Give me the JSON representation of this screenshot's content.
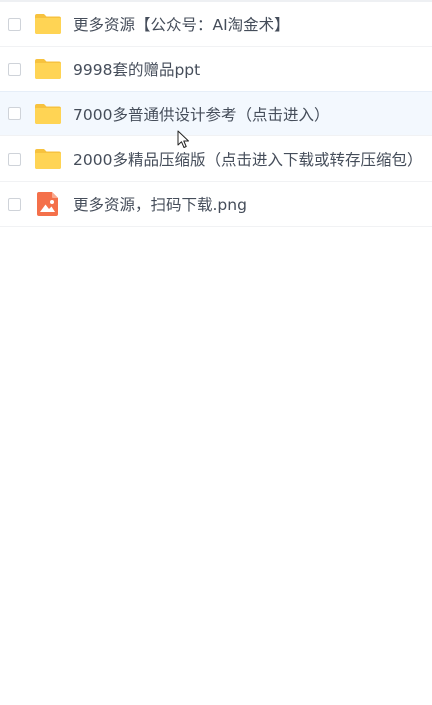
{
  "files": [
    {
      "name": "更多资源【公众号：AI淘金术】",
      "icon": "folder-icon",
      "selected": false
    },
    {
      "name": "9998套的赠品ppt",
      "icon": "folder-icon",
      "selected": false
    },
    {
      "name": "7000多普通供设计参考（点击进入）",
      "icon": "folder-icon",
      "selected": false
    },
    {
      "name": "2000多精品压缩版（点击进入下载或转存压缩包）",
      "icon": "folder-icon",
      "selected": false
    },
    {
      "name": "更多资源，扫码下载.png",
      "icon": "image-file-icon",
      "selected": false
    }
  ],
  "colors": {
    "folder": "#ffd454",
    "folder_tab": "#f7c23e",
    "image_file": "#f4704a",
    "hover_row": "#f3f8fe",
    "text": "#454d5a"
  }
}
